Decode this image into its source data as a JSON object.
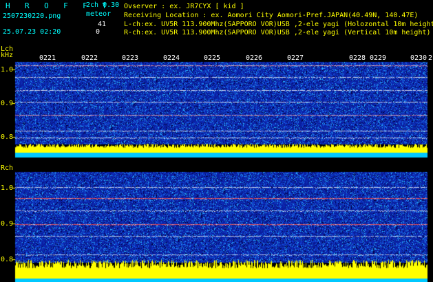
{
  "header": {
    "app_title": "H R O F F T",
    "mode": "2ch 0.30",
    "filename": "2507230220.png",
    "meteor_label": "meteor",
    "l_count": "41",
    "r_count": "0",
    "datetime": "25.07.23 02:20",
    "observer": "Ovserver          : ex. JR7CYX [ kid ]",
    "location": "Receiving Location : ex. Aomori City Aomori-Pref.JAPAN(40.49N, 140.47E)",
    "lch_info": "L-ch:ex. UV5R 113.900Mhz(SAPPORO VOR)USB ,2-ele yagi (Holozontal 10m height)",
    "rch_info": "R-ch:ex. UV5R 113.900Mhz(SAPPORO VOR)USB ,2-ele yagi (Vertical 10m height)"
  },
  "lch": {
    "label": "Lch",
    "unit": "kHz",
    "y_ticks": [
      "1.0",
      "0.9",
      "0.8"
    ],
    "time_ticks": [
      "0221",
      "0222",
      "0223",
      "0224",
      "0225",
      "0226",
      "0227",
      "0228",
      "0229",
      "0230"
    ],
    "end_tick": "2"
  },
  "rch": {
    "label": "Rch",
    "y_ticks": [
      "1.0",
      "0.9",
      "0.8"
    ]
  },
  "colors": {
    "noise_bg": "#0a1ea0",
    "signal_line": "#ffffff",
    "strong_line": "#ff2a2a",
    "level_bar": "#ffff00",
    "level_base": "#00c8ff",
    "text_info": "#ffff00",
    "text_cyan": "#00ffff"
  }
}
